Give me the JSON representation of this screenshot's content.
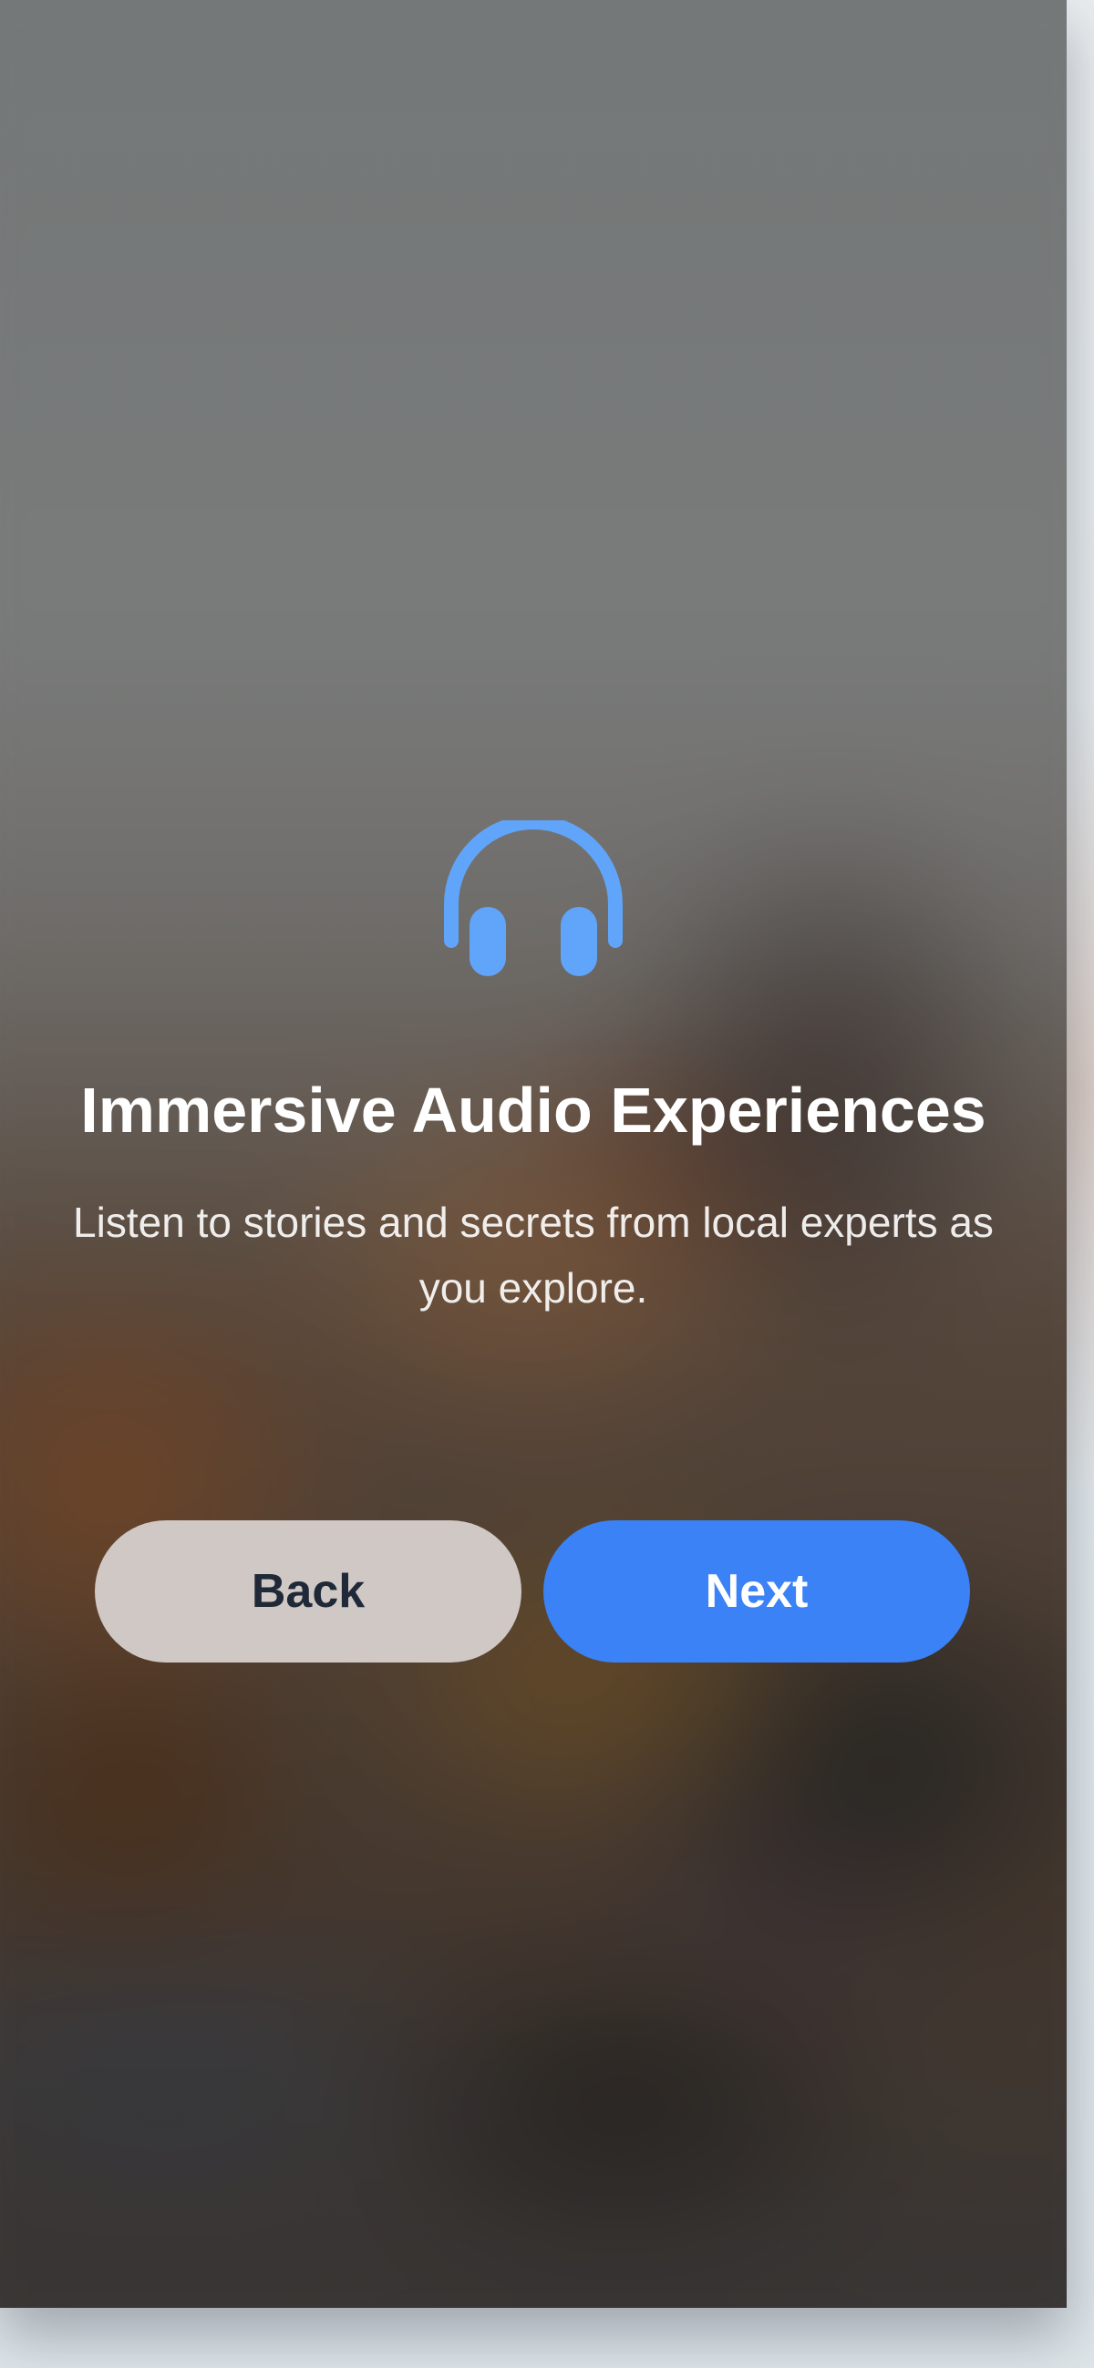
{
  "onboarding": {
    "icon": "headphones-icon",
    "title": "Immersive Audio Experiences",
    "subtitle": "Listen to stories and secrets from local experts as you explore.",
    "back_label": "Back",
    "next_label": "Next"
  },
  "colors": {
    "accent": "#3b82f6",
    "icon": "#60a5fa",
    "back_button_bg": "#d6d0cd",
    "back_button_text": "#1f2937"
  }
}
